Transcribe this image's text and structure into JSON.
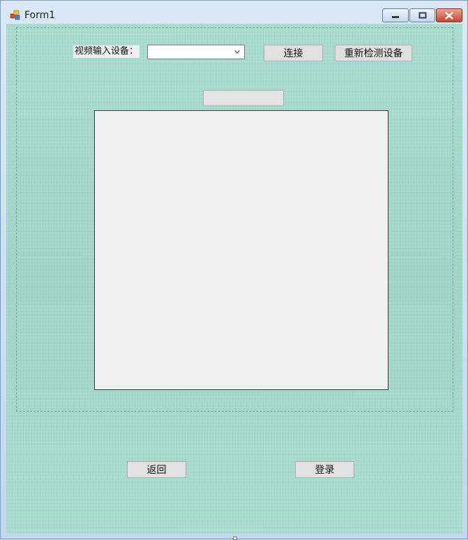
{
  "window": {
    "title": "Form1"
  },
  "form": {
    "device_label": "视频输入设备：",
    "device_select": {
      "value": ""
    },
    "connect_button": "连接",
    "redetect_button": "重新检测设备",
    "blank_button": "",
    "back_button": "返回",
    "login_button": "登录"
  },
  "colors": {
    "client_background": "#a7dccf",
    "control_face": "#e1e1e1",
    "picture_background": "#f0f0f0",
    "close_button": "#c8452b"
  },
  "icons": {
    "app": "winforms-app-icon",
    "minimize": "minimize-icon",
    "maximize": "maximize-icon",
    "close": "close-icon",
    "dropdown": "chevron-down-icon"
  }
}
